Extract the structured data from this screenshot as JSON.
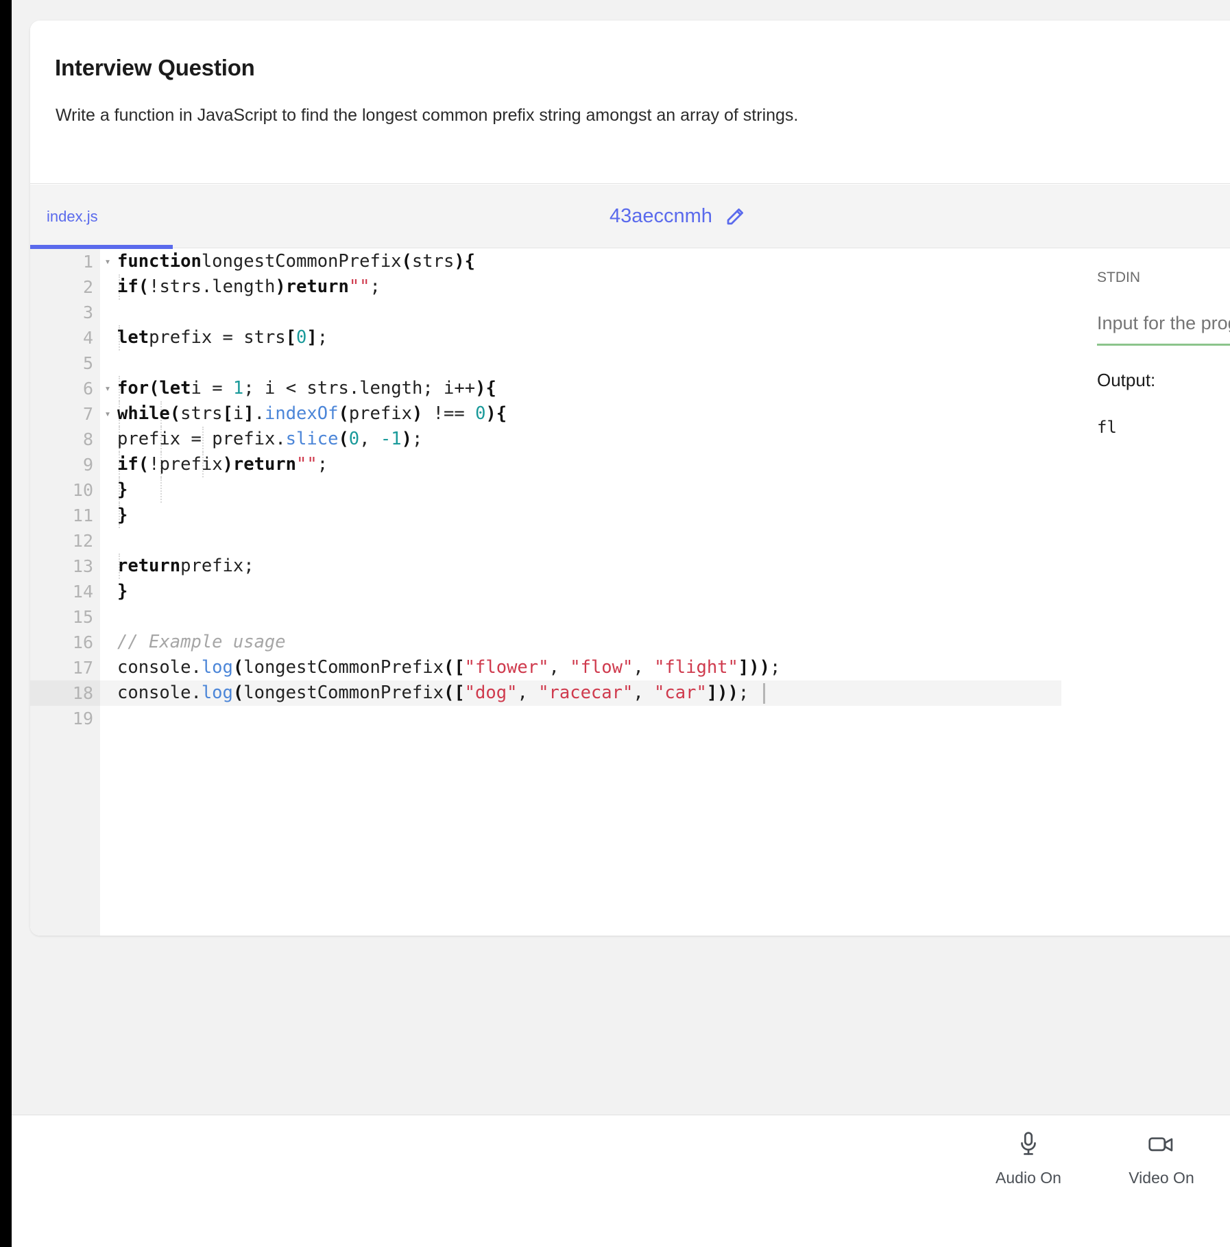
{
  "question": {
    "title": "Interview Question",
    "text": "Write a function in JavaScript to find the longest common prefix string amongst an array of strings."
  },
  "editor": {
    "tab_label": "index.js",
    "session_id": "43aeccnmh",
    "edit_icon": "pencil-icon",
    "active_line": 18,
    "cursor_line": 18,
    "lines": [
      {
        "n": "1",
        "fold": "▾",
        "indent": 0
      },
      {
        "n": "2",
        "fold": "",
        "indent": 1
      },
      {
        "n": "3",
        "fold": "",
        "indent": 0
      },
      {
        "n": "4",
        "fold": "",
        "indent": 1
      },
      {
        "n": "5",
        "fold": "",
        "indent": 0
      },
      {
        "n": "6",
        "fold": "▾",
        "indent": 1
      },
      {
        "n": "7",
        "fold": "▾",
        "indent": 2
      },
      {
        "n": "8",
        "fold": "",
        "indent": 3
      },
      {
        "n": "9",
        "fold": "",
        "indent": 3
      },
      {
        "n": "10",
        "fold": "",
        "indent": 2
      },
      {
        "n": "11",
        "fold": "",
        "indent": 1
      },
      {
        "n": "12",
        "fold": "",
        "indent": 0
      },
      {
        "n": "13",
        "fold": "",
        "indent": 1
      },
      {
        "n": "14",
        "fold": "",
        "indent": 0
      },
      {
        "n": "15",
        "fold": "",
        "indent": 0
      },
      {
        "n": "16",
        "fold": "",
        "indent": 0
      },
      {
        "n": "17",
        "fold": "",
        "indent": 0
      },
      {
        "n": "18",
        "fold": "",
        "indent": 0
      },
      {
        "n": "19",
        "fold": "",
        "indent": 0
      }
    ],
    "code": [
      "function longestCommonPrefix(strs) {",
      "    if (!strs.length) return \"\";",
      "",
      "    let prefix = strs[0];",
      "",
      "    for (let i = 1; i < strs.length; i++) {",
      "        while (strs[i].indexOf(prefix) !== 0) {",
      "            prefix = prefix.slice(0, -1);",
      "            if (!prefix) return \"\";",
      "        }",
      "    }",
      "",
      "    return prefix;",
      "}",
      "",
      "// Example usage",
      "console.log(longestCommonPrefix([\"flower\", \"flow\", \"flight\"]));",
      "console.log(longestCommonPrefix([\"dog\", \"racecar\", \"car\"]));",
      ""
    ]
  },
  "io": {
    "stdin_label": "STDIN",
    "stdin_value": "",
    "stdin_placeholder": "Input for the program",
    "output_label": "Output:",
    "output_value": "fl"
  },
  "bottom_bar": {
    "audio": {
      "label": "Audio On",
      "icon": "microphone-icon"
    },
    "video": {
      "label": "Video On",
      "icon": "video-camera-icon"
    }
  },
  "colors": {
    "accent": "#5a6aec",
    "string": "#cf3a4d",
    "number": "#1a9a9a",
    "function": "#4c86d8",
    "comment": "#a6a6a6",
    "stdin_underline": "#8bc48b"
  }
}
